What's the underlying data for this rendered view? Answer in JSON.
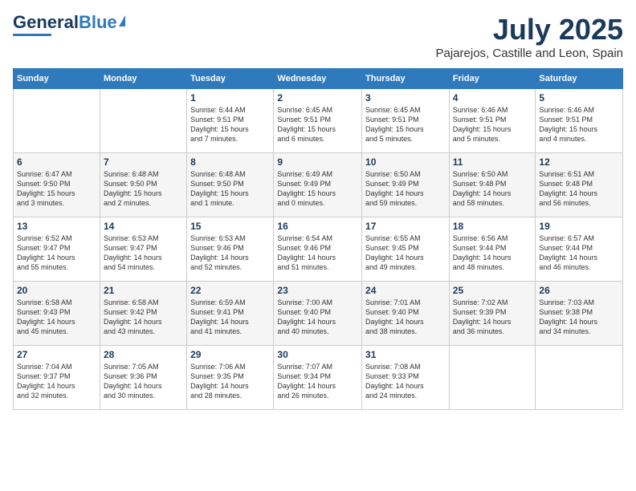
{
  "header": {
    "logo_line1": "General",
    "logo_line2": "Blue",
    "month": "July 2025",
    "location": "Pajarejos, Castille and Leon, Spain"
  },
  "weekdays": [
    "Sunday",
    "Monday",
    "Tuesday",
    "Wednesday",
    "Thursday",
    "Friday",
    "Saturday"
  ],
  "weeks": [
    [
      {
        "day": "",
        "info": ""
      },
      {
        "day": "",
        "info": ""
      },
      {
        "day": "1",
        "info": "Sunrise: 6:44 AM\nSunset: 9:51 PM\nDaylight: 15 hours\nand 7 minutes."
      },
      {
        "day": "2",
        "info": "Sunrise: 6:45 AM\nSunset: 9:51 PM\nDaylight: 15 hours\nand 6 minutes."
      },
      {
        "day": "3",
        "info": "Sunrise: 6:45 AM\nSunset: 9:51 PM\nDaylight: 15 hours\nand 5 minutes."
      },
      {
        "day": "4",
        "info": "Sunrise: 6:46 AM\nSunset: 9:51 PM\nDaylight: 15 hours\nand 5 minutes."
      },
      {
        "day": "5",
        "info": "Sunrise: 6:46 AM\nSunset: 9:51 PM\nDaylight: 15 hours\nand 4 minutes."
      }
    ],
    [
      {
        "day": "6",
        "info": "Sunrise: 6:47 AM\nSunset: 9:50 PM\nDaylight: 15 hours\nand 3 minutes."
      },
      {
        "day": "7",
        "info": "Sunrise: 6:48 AM\nSunset: 9:50 PM\nDaylight: 15 hours\nand 2 minutes."
      },
      {
        "day": "8",
        "info": "Sunrise: 6:48 AM\nSunset: 9:50 PM\nDaylight: 15 hours\nand 1 minute."
      },
      {
        "day": "9",
        "info": "Sunrise: 6:49 AM\nSunset: 9:49 PM\nDaylight: 15 hours\nand 0 minutes."
      },
      {
        "day": "10",
        "info": "Sunrise: 6:50 AM\nSunset: 9:49 PM\nDaylight: 14 hours\nand 59 minutes."
      },
      {
        "day": "11",
        "info": "Sunrise: 6:50 AM\nSunset: 9:48 PM\nDaylight: 14 hours\nand 58 minutes."
      },
      {
        "day": "12",
        "info": "Sunrise: 6:51 AM\nSunset: 9:48 PM\nDaylight: 14 hours\nand 56 minutes."
      }
    ],
    [
      {
        "day": "13",
        "info": "Sunrise: 6:52 AM\nSunset: 9:47 PM\nDaylight: 14 hours\nand 55 minutes."
      },
      {
        "day": "14",
        "info": "Sunrise: 6:53 AM\nSunset: 9:47 PM\nDaylight: 14 hours\nand 54 minutes."
      },
      {
        "day": "15",
        "info": "Sunrise: 6:53 AM\nSunset: 9:46 PM\nDaylight: 14 hours\nand 52 minutes."
      },
      {
        "day": "16",
        "info": "Sunrise: 6:54 AM\nSunset: 9:46 PM\nDaylight: 14 hours\nand 51 minutes."
      },
      {
        "day": "17",
        "info": "Sunrise: 6:55 AM\nSunset: 9:45 PM\nDaylight: 14 hours\nand 49 minutes."
      },
      {
        "day": "18",
        "info": "Sunrise: 6:56 AM\nSunset: 9:44 PM\nDaylight: 14 hours\nand 48 minutes."
      },
      {
        "day": "19",
        "info": "Sunrise: 6:57 AM\nSunset: 9:44 PM\nDaylight: 14 hours\nand 46 minutes."
      }
    ],
    [
      {
        "day": "20",
        "info": "Sunrise: 6:58 AM\nSunset: 9:43 PM\nDaylight: 14 hours\nand 45 minutes."
      },
      {
        "day": "21",
        "info": "Sunrise: 6:58 AM\nSunset: 9:42 PM\nDaylight: 14 hours\nand 43 minutes."
      },
      {
        "day": "22",
        "info": "Sunrise: 6:59 AM\nSunset: 9:41 PM\nDaylight: 14 hours\nand 41 minutes."
      },
      {
        "day": "23",
        "info": "Sunrise: 7:00 AM\nSunset: 9:40 PM\nDaylight: 14 hours\nand 40 minutes."
      },
      {
        "day": "24",
        "info": "Sunrise: 7:01 AM\nSunset: 9:40 PM\nDaylight: 14 hours\nand 38 minutes."
      },
      {
        "day": "25",
        "info": "Sunrise: 7:02 AM\nSunset: 9:39 PM\nDaylight: 14 hours\nand 36 minutes."
      },
      {
        "day": "26",
        "info": "Sunrise: 7:03 AM\nSunset: 9:38 PM\nDaylight: 14 hours\nand 34 minutes."
      }
    ],
    [
      {
        "day": "27",
        "info": "Sunrise: 7:04 AM\nSunset: 9:37 PM\nDaylight: 14 hours\nand 32 minutes."
      },
      {
        "day": "28",
        "info": "Sunrise: 7:05 AM\nSunset: 9:36 PM\nDaylight: 14 hours\nand 30 minutes."
      },
      {
        "day": "29",
        "info": "Sunrise: 7:06 AM\nSunset: 9:35 PM\nDaylight: 14 hours\nand 28 minutes."
      },
      {
        "day": "30",
        "info": "Sunrise: 7:07 AM\nSunset: 9:34 PM\nDaylight: 14 hours\nand 26 minutes."
      },
      {
        "day": "31",
        "info": "Sunrise: 7:08 AM\nSunset: 9:33 PM\nDaylight: 14 hours\nand 24 minutes."
      },
      {
        "day": "",
        "info": ""
      },
      {
        "day": "",
        "info": ""
      }
    ]
  ]
}
